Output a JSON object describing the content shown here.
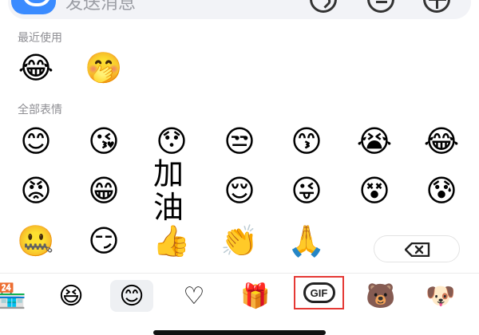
{
  "input": {
    "placeholder": "发送消息"
  },
  "sections": {
    "recent_title": "最近使用",
    "all_title": "全部表情"
  },
  "recent_emojis": [
    {
      "name": "tears-of-joy-emoji",
      "glyph": "😂"
    },
    {
      "name": "covering-mouth-emoji",
      "glyph": "🤭"
    }
  ],
  "all_emojis": [
    {
      "name": "smiling-emoji",
      "glyph": "😊"
    },
    {
      "name": "heart-eyes-kiss-emoji",
      "glyph": "😘"
    },
    {
      "name": "surprised-emoji",
      "glyph": "😯"
    },
    {
      "name": "unamused-emoji",
      "glyph": "😒"
    },
    {
      "name": "thinking-kiss-emoji",
      "glyph": "😙"
    },
    {
      "name": "crying-emoji",
      "glyph": "😭"
    },
    {
      "name": "laughing-tears-emoji",
      "glyph": "😂"
    },
    {
      "name": "angry-emoji",
      "glyph": "😡"
    },
    {
      "name": "grinning-emoji",
      "glyph": "😁"
    },
    {
      "name": "jiayou-emoji",
      "glyph": "加油"
    },
    {
      "name": "shy-emoji",
      "glyph": "😌"
    },
    {
      "name": "wink-tongue-emoji",
      "glyph": "😜"
    },
    {
      "name": "dizzy-emoji",
      "glyph": "😵"
    },
    {
      "name": "black-sweat-emoji",
      "glyph": "😰"
    },
    {
      "name": "shushing-emoji",
      "glyph": "🤐"
    },
    {
      "name": "smirk-pointing-emoji",
      "glyph": "😏"
    },
    {
      "name": "thumbs-up-emoji",
      "glyph": "👍"
    },
    {
      "name": "clapping-emoji",
      "glyph": "👏"
    },
    {
      "name": "praying-hands-emoji",
      "glyph": "🙏"
    }
  ],
  "bottom_tabs": [
    {
      "name": "store-icon",
      "glyph": "🏪"
    },
    {
      "name": "smile-sticker-icon",
      "glyph": "😆"
    },
    {
      "name": "emoji-tab-icon",
      "glyph": "😊",
      "selected": true
    },
    {
      "name": "heart-icon",
      "glyph": "♡"
    },
    {
      "name": "cup-sticker-icon",
      "glyph": "🎁"
    },
    {
      "name": "bear-sticker-icon",
      "glyph": "🐻"
    },
    {
      "name": "dog-sticker-icon",
      "glyph": "🐶"
    }
  ],
  "gif_label": "GIF",
  "colors": {
    "accent": "#3a8bff",
    "gif_highlight": "#e53935",
    "jiayou_pink": "#f06292"
  }
}
